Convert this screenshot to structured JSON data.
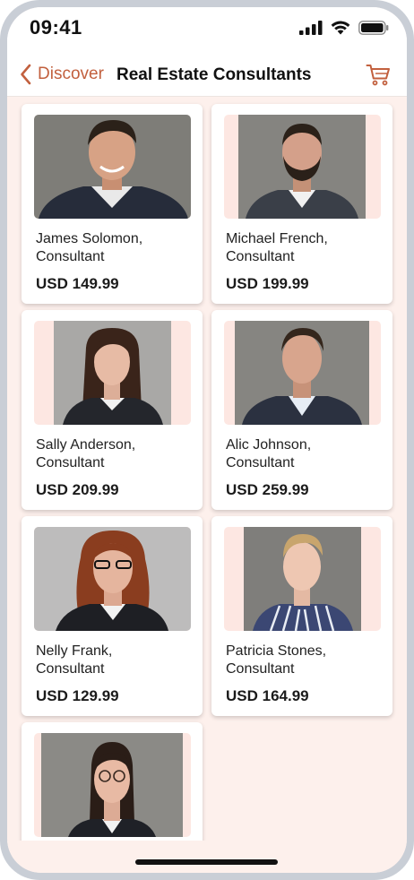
{
  "status_bar": {
    "time": "09:41"
  },
  "nav": {
    "back_label": "Discover",
    "title": "Real Estate Consultants"
  },
  "colors": {
    "accent": "#c2603e",
    "background": "#fdf0ec",
    "card": "#ffffff"
  },
  "consultants": [
    {
      "name_line1": "James Solomon,",
      "name_line2": "Consultant",
      "price": "USD 149.99"
    },
    {
      "name_line1": "Michael French,",
      "name_line2": "Consultant",
      "price": "USD 199.99"
    },
    {
      "name_line1": "Sally Anderson,",
      "name_line2": "Consultant",
      "price": "USD 209.99"
    },
    {
      "name_line1": "Alic Johnson,",
      "name_line2": "Consultant",
      "price": "USD 259.99"
    },
    {
      "name_line1": "Nelly Frank,",
      "name_line2": "Consultant",
      "price": "USD 129.99"
    },
    {
      "name_line1": "Patricia Stones,",
      "name_line2": "Consultant",
      "price": "USD 164.99"
    },
    {
      "name_line1": "",
      "name_line2": "",
      "price": ""
    }
  ]
}
